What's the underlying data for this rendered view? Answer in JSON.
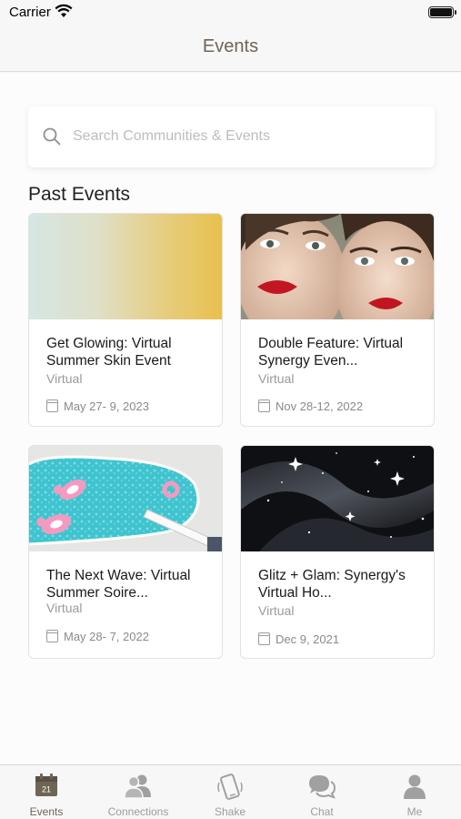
{
  "status": {
    "carrier": "Carrier"
  },
  "nav": {
    "title": "Events"
  },
  "search": {
    "placeholder": "Search Communities & Events"
  },
  "section": {
    "title": "Past Events"
  },
  "events": [
    {
      "title": "Get Glowing: Virtual Summer Skin Event",
      "venue": "Virtual",
      "date": "May 27- 9, 2023",
      "image": "gradient-image"
    },
    {
      "title": "Double Feature: Virtual Synergy Even...",
      "venue": "Virtual",
      "date": "Nov 28-12, 2022",
      "image": "two-faces-image"
    },
    {
      "title": "The Next Wave: Virtual Summer Soire...",
      "venue": "Virtual",
      "date": "May 28- 7, 2022",
      "image": "pool-image"
    },
    {
      "title": "Glitz + Glam: Synergy's Virtual Ho...",
      "venue": "Virtual",
      "date": "Dec 9, 2021",
      "image": "sparkle-image"
    }
  ],
  "tabs": [
    {
      "label": "Events",
      "icon": "calendar-icon",
      "active": true,
      "badge": "21"
    },
    {
      "label": "Connections",
      "icon": "people-icon",
      "active": false
    },
    {
      "label": "Shake",
      "icon": "phone-shake-icon",
      "active": false
    },
    {
      "label": "Chat",
      "icon": "chat-bubbles-icon",
      "active": false
    },
    {
      "label": "Me",
      "icon": "person-icon",
      "active": false
    }
  ],
  "colors": {
    "accent": "#6f6555",
    "inactive": "#9c9c9c",
    "placeholder": "#bdbdbd"
  }
}
